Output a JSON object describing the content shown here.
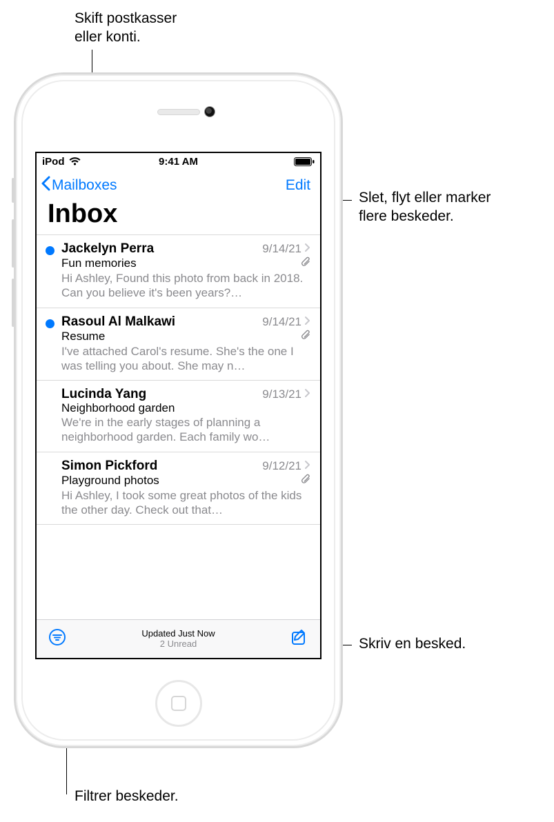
{
  "callouts": {
    "mailboxes": "Skift postkasser\neller konti.",
    "edit": "Slet, flyt eller marker\nflere beskeder.",
    "compose": "Skriv en besked.",
    "filter": "Filtrer beskeder."
  },
  "statusbar": {
    "carrier": "iPod",
    "time": "9:41 AM"
  },
  "nav": {
    "back": "Mailboxes",
    "edit": "Edit",
    "title": "Inbox"
  },
  "messages": [
    {
      "sender": "Jackelyn Perra",
      "date": "9/14/21",
      "subject": "Fun memories",
      "preview": "Hi Ashley, Found this photo from back in 2018. Can you believe it's been years?…",
      "unread": true,
      "attachment": true
    },
    {
      "sender": "Rasoul Al Malkawi",
      "date": "9/14/21",
      "subject": "Resume",
      "preview": "I've attached Carol's resume. She's the one I was telling you about. She may n…",
      "unread": true,
      "attachment": true
    },
    {
      "sender": "Lucinda Yang",
      "date": "9/13/21",
      "subject": "Neighborhood garden",
      "preview": "We're in the early stages of planning a neighborhood garden. Each family wo…",
      "unread": false,
      "attachment": false
    },
    {
      "sender": "Simon Pickford",
      "date": "9/12/21",
      "subject": "Playground photos",
      "preview": "Hi Ashley, I took some great photos of the kids the other day. Check out that…",
      "unread": false,
      "attachment": true
    }
  ],
  "toolbar": {
    "status": "Updated Just Now",
    "unread": "2 Unread"
  }
}
